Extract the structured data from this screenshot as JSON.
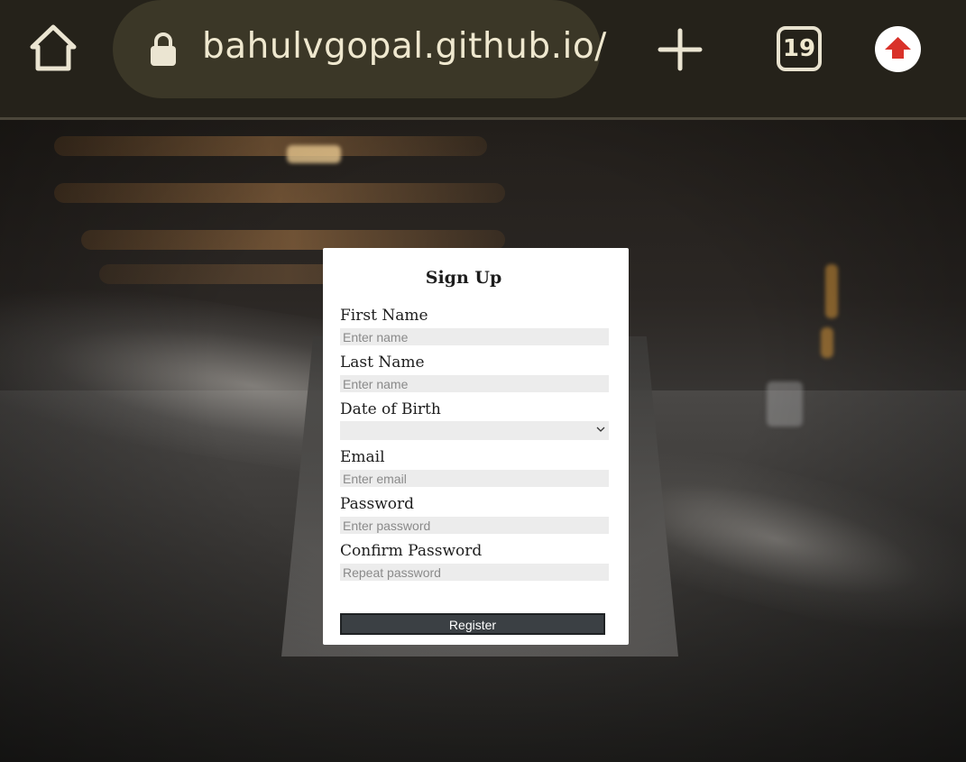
{
  "browser": {
    "url": "bahulvgopal.github.io/",
    "tab_count": "19",
    "icons": {
      "home": "home-icon",
      "lock": "lock-icon",
      "new_tab": "plus-icon",
      "tabs": "tabs-counter-icon",
      "upload": "arrow-up-icon"
    },
    "colors": {
      "toolbar": "#25221a",
      "url_bar": "#3b3727",
      "upload_arrow": "#d9322a"
    }
  },
  "form": {
    "title": "Sign Up",
    "fields": [
      {
        "label": "First Name",
        "placeholder": "Enter name",
        "value": ""
      },
      {
        "label": "Last Name",
        "placeholder": "Enter name",
        "value": ""
      },
      {
        "label": "Date of Birth",
        "selected": ""
      },
      {
        "label": "Email",
        "placeholder": "Enter email",
        "value": ""
      },
      {
        "label": "Password",
        "placeholder": "Enter password",
        "value": ""
      },
      {
        "label": "Confirm Password",
        "placeholder": "Repeat password",
        "value": ""
      }
    ],
    "submit_label": "Register",
    "colors": {
      "card": "#ffffff",
      "input_bg": "#ececec",
      "button_bg": "#3b4044"
    }
  }
}
